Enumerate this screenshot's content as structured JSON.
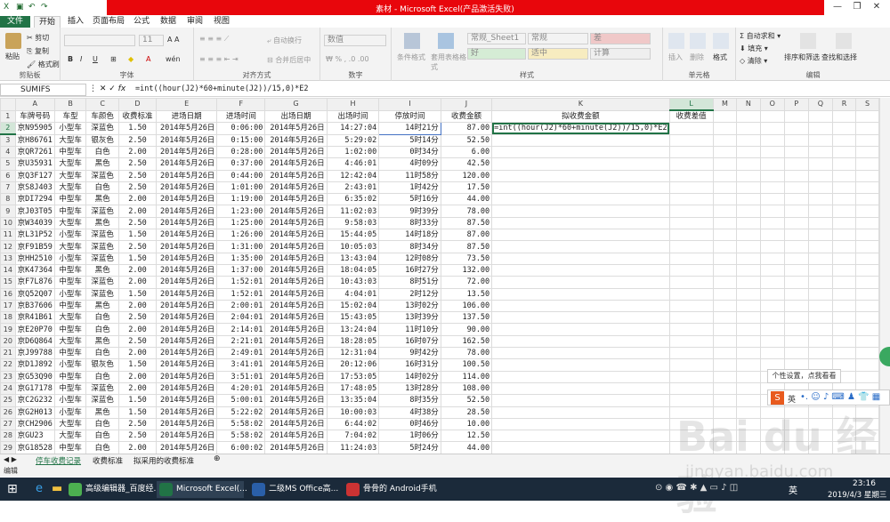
{
  "window": {
    "title": "素材 - Microsoft Excel(产品激活失败)"
  },
  "tabs": [
    "文件",
    "开始",
    "插入",
    "页面布局",
    "公式",
    "数据",
    "审阅",
    "视图"
  ],
  "ribbon": {
    "clipboard": {
      "paste": "粘贴",
      "cut": "剪切",
      "copy": "复制",
      "format_painter": "格式刷",
      "label": "剪贴板"
    },
    "font": {
      "size": "11",
      "bold": "B",
      "italic": "I",
      "underline": "U",
      "label": "字体"
    },
    "alignment": {
      "wrap": "自动换行",
      "merge": "合并后居中",
      "label": "对齐方式"
    },
    "number": {
      "format": "数值",
      "label": "数字"
    },
    "styles": {
      "cond": "条件格式",
      "table": "套用表格格式",
      "s1": "常规_Sheet1",
      "s2": "常规",
      "s3": "差",
      "s4": "好",
      "s5": "适中",
      "s6": "计算",
      "label": "样式"
    },
    "cells": {
      "insert": "插入",
      "delete": "删除",
      "format": "格式",
      "label": "单元格"
    },
    "editing": {
      "autosum": "自动求和",
      "fill": "填充",
      "clear": "清除",
      "sort": "排序和筛选",
      "find": "查找和选择",
      "label": "编辑"
    }
  },
  "formula_bar": {
    "name_box": "SUMIFS",
    "formula": "=int((hour(J2)*60+minute(J2))/15,0)*E2"
  },
  "columns": [
    "A",
    "B",
    "C",
    "D",
    "E",
    "F",
    "G",
    "H",
    "I",
    "J",
    "K",
    "L",
    "M",
    "N",
    "O",
    "P",
    "Q",
    "R",
    "S"
  ],
  "headers": [
    "车牌号码",
    "车型",
    "车颜色",
    "收费标准",
    "进场日期",
    "进场时间",
    "出场日期",
    "出场时间",
    "停放时间",
    "收费金额",
    "拟收费金额",
    "收费差值"
  ],
  "rows": [
    [
      "京N95905",
      "小型车",
      "深蓝色",
      "1.50",
      "2014年5月26日",
      "0:06:00",
      "2014年5月26日",
      "14:27:04",
      "14时21分",
      "87.00"
    ],
    [
      "京H86761",
      "大型车",
      "银灰色",
      "2.50",
      "2014年5月26日",
      "0:15:00",
      "2014年5月26日",
      "5:29:02",
      "5时14分",
      "52.50"
    ],
    [
      "京QR7261",
      "中型车",
      "白色",
      "2.00",
      "2014年5月26日",
      "0:28:00",
      "2014年5月26日",
      "1:02:00",
      "0时34分",
      "6.00"
    ],
    [
      "京U35931",
      "大型车",
      "黑色",
      "2.50",
      "2014年5月26日",
      "0:37:00",
      "2014年5月26日",
      "4:46:01",
      "4时09分",
      "42.50"
    ],
    [
      "京Q3F127",
      "大型车",
      "深蓝色",
      "2.50",
      "2014年5月26日",
      "0:44:00",
      "2014年5月26日",
      "12:42:04",
      "11时58分",
      "120.00"
    ],
    [
      "京S8J403",
      "大型车",
      "白色",
      "2.50",
      "2014年5月26日",
      "1:01:00",
      "2014年5月26日",
      "2:43:01",
      "1时42分",
      "17.50"
    ],
    [
      "京DI7294",
      "中型车",
      "黑色",
      "2.00",
      "2014年5月26日",
      "1:19:00",
      "2014年5月26日",
      "6:35:02",
      "5时16分",
      "44.00"
    ],
    [
      "京J03T05",
      "中型车",
      "深蓝色",
      "2.00",
      "2014年5月26日",
      "1:23:00",
      "2014年5月26日",
      "11:02:03",
      "9时39分",
      "78.00"
    ],
    [
      "京W34039",
      "大型车",
      "黑色",
      "2.50",
      "2014年5月26日",
      "1:25:00",
      "2014年5月26日",
      "9:58:03",
      "8时33分",
      "87.50"
    ],
    [
      "京L31P52",
      "小型车",
      "深蓝色",
      "1.50",
      "2014年5月26日",
      "1:26:00",
      "2014年5月26日",
      "15:44:05",
      "14时18分",
      "87.00"
    ],
    [
      "京F91B59",
      "大型车",
      "深蓝色",
      "2.50",
      "2014年5月26日",
      "1:31:00",
      "2014年5月26日",
      "10:05:03",
      "8时34分",
      "87.50"
    ],
    [
      "京HH2510",
      "小型车",
      "深蓝色",
      "1.50",
      "2014年5月26日",
      "1:35:00",
      "2014年5月26日",
      "13:43:04",
      "12时08分",
      "73.50"
    ],
    [
      "京K47364",
      "中型车",
      "黑色",
      "2.00",
      "2014年5月26日",
      "1:37:00",
      "2014年5月26日",
      "18:04:05",
      "16时27分",
      "132.00"
    ],
    [
      "京F7L876",
      "中型车",
      "深蓝色",
      "2.00",
      "2014年5月26日",
      "1:52:01",
      "2014年5月26日",
      "10:43:03",
      "8时51分",
      "72.00"
    ],
    [
      "京Q52Q07",
      "小型车",
      "深蓝色",
      "1.50",
      "2014年5月26日",
      "1:52:01",
      "2014年5月26日",
      "4:04:01",
      "2时12分",
      "13.50"
    ],
    [
      "京B37606",
      "中型车",
      "黑色",
      "2.00",
      "2014年5月26日",
      "2:00:01",
      "2014年5月26日",
      "15:02:04",
      "13时02分",
      "106.00"
    ],
    [
      "京R41B61",
      "大型车",
      "白色",
      "2.50",
      "2014年5月26日",
      "2:04:01",
      "2014年5月26日",
      "15:43:05",
      "13时39分",
      "137.50"
    ],
    [
      "京E20P70",
      "中型车",
      "白色",
      "2.00",
      "2014年5月26日",
      "2:14:01",
      "2014年5月26日",
      "13:24:04",
      "11时10分",
      "90.00"
    ],
    [
      "京D6Q864",
      "大型车",
      "黑色",
      "2.50",
      "2014年5月26日",
      "2:21:01",
      "2014年5月26日",
      "18:28:05",
      "16时07分",
      "162.50"
    ],
    [
      "京J99788",
      "中型车",
      "白色",
      "2.00",
      "2014年5月26日",
      "2:49:01",
      "2014年5月26日",
      "12:31:04",
      "9时42分",
      "78.00"
    ],
    [
      "京D1J892",
      "小型车",
      "银灰色",
      "1.50",
      "2014年5月26日",
      "3:41:01",
      "2014年5月26日",
      "20:12:06",
      "16时31分",
      "100.50"
    ],
    [
      "京G53Q90",
      "中型车",
      "白色",
      "2.00",
      "2014年5月26日",
      "3:51:01",
      "2014年5月26日",
      "17:53:05",
      "14时02分",
      "114.00"
    ],
    [
      "京G17178",
      "中型车",
      "深蓝色",
      "2.00",
      "2014年5月26日",
      "4:20:01",
      "2014年5月26日",
      "17:48:05",
      "13时28分",
      "108.00"
    ],
    [
      "京C2G232",
      "小型车",
      "深蓝色",
      "1.50",
      "2014年5月26日",
      "5:00:01",
      "2014年5月26日",
      "13:35:04",
      "8时35分",
      "52.50"
    ],
    [
      "京G2H013",
      "小型车",
      "黑色",
      "1.50",
      "2014年5月26日",
      "5:22:02",
      "2014年5月26日",
      "10:00:03",
      "4时38分",
      "28.50"
    ],
    [
      "京CH2906",
      "大型车",
      "白色",
      "2.50",
      "2014年5月26日",
      "5:58:02",
      "2014年5月26日",
      "6:44:02",
      "0时46分",
      "10.00"
    ],
    [
      "京GU23",
      "大型车",
      "白色",
      "2.50",
      "2014年5月26日",
      "5:58:02",
      "2014年5月26日",
      "7:04:02",
      "1时06分",
      "12.50"
    ],
    [
      "京G18528",
      "中型车",
      "白色",
      "2.00",
      "2014年5月26日",
      "6:00:02",
      "2014年5月26日",
      "11:24:03",
      "5时24分",
      "44.00"
    ]
  ],
  "sheet_tabs": [
    "停车收费记录",
    "收费标准",
    "拟采用的收费标准"
  ],
  "status": {
    "mode": "编辑"
  },
  "ime": {
    "tooltip": "个性设置，点我看看",
    "label": "英"
  },
  "watermark": {
    "main": "Bai du 经验",
    "sub": "jingyan.baidu.com"
  },
  "taskbar": {
    "items": [
      "高级编辑器_百度经...",
      "Microsoft Excel(...",
      "二级MS Office高...",
      "骨骨的 Android手机"
    ],
    "lang": "英",
    "time": "23:16",
    "date": "2019/4/3 星期三"
  }
}
